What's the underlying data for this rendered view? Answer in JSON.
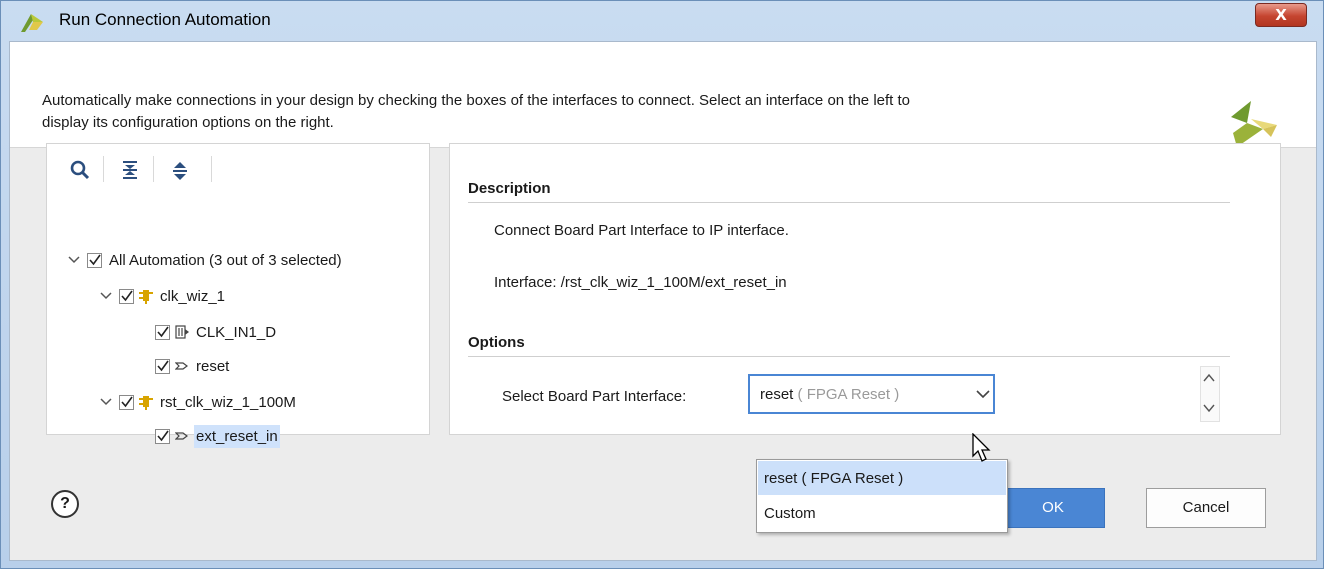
{
  "window": {
    "title": "Run Connection Automation",
    "close_label": "X"
  },
  "header": {
    "description_line1": "Automatically make connections in your design by checking the boxes of the interfaces to connect. Select an interface on the left to",
    "description_line2": "display its configuration options on the right."
  },
  "toolbar": {
    "search_icon": "search-icon",
    "collapse_all_icon": "collapse-all-icon",
    "expand_all_icon": "expand-all-icon"
  },
  "tree": {
    "root": {
      "label": "All Automation (3 out of 3 selected)",
      "checked": true,
      "expanded": true
    },
    "nodes": [
      {
        "label": "clk_wiz_1",
        "checked": true,
        "expanded": true,
        "icon": "ip-block-icon",
        "children": [
          {
            "label": "CLK_IN1_D",
            "checked": true,
            "icon": "diff-clock-icon"
          },
          {
            "label": "reset",
            "checked": true,
            "icon": "port-arrow-icon"
          }
        ]
      },
      {
        "label": "rst_clk_wiz_1_100M",
        "checked": true,
        "expanded": true,
        "icon": "ip-block-icon",
        "children": [
          {
            "label": "ext_reset_in",
            "checked": true,
            "icon": "port-arrow-icon",
            "selected": true
          }
        ]
      }
    ]
  },
  "details": {
    "description_title": "Description",
    "description_text": "Connect Board Part Interface to IP interface.",
    "interface_text": "Interface: /rst_clk_wiz_1_100M/ext_reset_in",
    "options_title": "Options",
    "select_label": "Select Board Part Interface:",
    "select_value": "reset",
    "select_value_hint": "( FPGA Reset )",
    "options": [
      "reset ( FPGA Reset )",
      "Custom"
    ]
  },
  "footer": {
    "help_label": "?",
    "ok_label": "OK",
    "cancel_label": "Cancel"
  },
  "colors": {
    "accent": "#4a86d4",
    "selection": "#cfe2fb",
    "titlebar": "#c9dcf1"
  }
}
